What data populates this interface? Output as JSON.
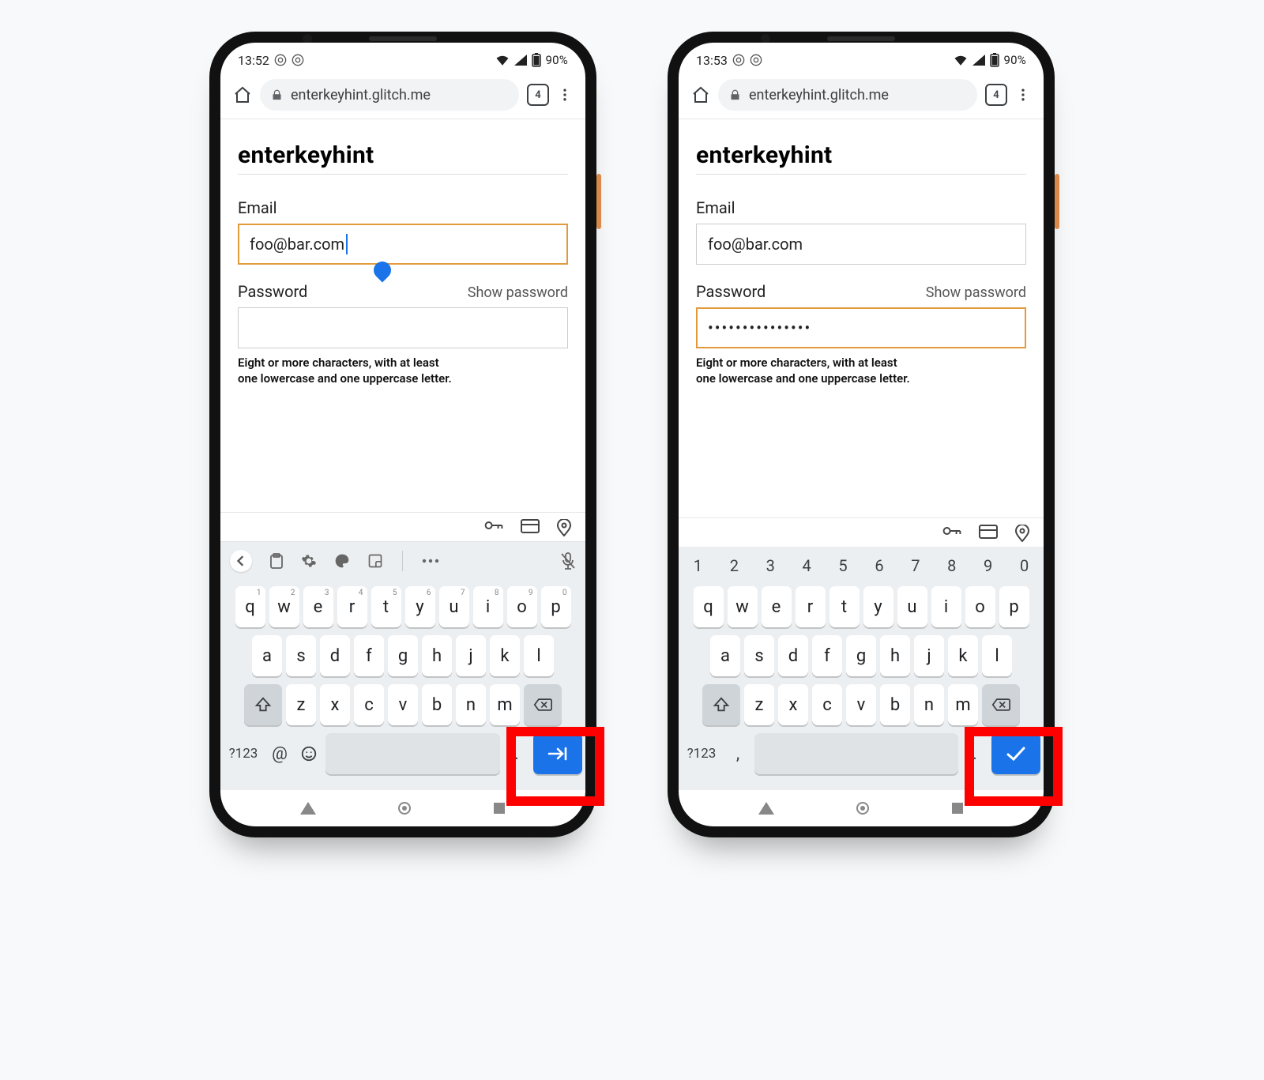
{
  "phones": [
    {
      "status": {
        "time": "13:52",
        "battery_text": "90%"
      },
      "browser": {
        "url": "enterkeyhint.glitch.me",
        "tab_count": "4"
      },
      "page": {
        "title": "enterkeyhint",
        "email_label": "Email",
        "email_value": "foo@bar.com",
        "email_focused": true,
        "password_label": "Password",
        "show_password": "Show password",
        "password_value": "",
        "password_focused": false,
        "helper": "Eight or more characters, with at least\none lowercase and one uppercase letter."
      },
      "keyboard": {
        "show_number_row": false,
        "show_suggestion_strip": true,
        "row1": [
          "q",
          "w",
          "e",
          "r",
          "t",
          "y",
          "u",
          "i",
          "o",
          "p"
        ],
        "row1_sup": [
          "1",
          "2",
          "3",
          "4",
          "5",
          "6",
          "7",
          "8",
          "9",
          "0"
        ],
        "row2": [
          "a",
          "s",
          "d",
          "f",
          "g",
          "h",
          "j",
          "k",
          "l"
        ],
        "row3": [
          "z",
          "x",
          "c",
          "v",
          "b",
          "n",
          "m"
        ],
        "bottom_left_label": "?123",
        "bottom_extra1": "@",
        "bottom_extra2_is_emoji": true,
        "bottom_period": ".",
        "enter_kind": "next"
      }
    },
    {
      "status": {
        "time": "13:53",
        "battery_text": "90%"
      },
      "browser": {
        "url": "enterkeyhint.glitch.me",
        "tab_count": "4"
      },
      "page": {
        "title": "enterkeyhint",
        "email_label": "Email",
        "email_value": "foo@bar.com",
        "email_focused": false,
        "password_label": "Password",
        "show_password": "Show password",
        "password_value": "•••••••••••••••",
        "password_focused": true,
        "helper": "Eight or more characters, with at least\none lowercase and one uppercase letter."
      },
      "keyboard": {
        "show_number_row": true,
        "show_suggestion_strip": false,
        "number_row": [
          "1",
          "2",
          "3",
          "4",
          "5",
          "6",
          "7",
          "8",
          "9",
          "0"
        ],
        "row1": [
          "q",
          "w",
          "e",
          "r",
          "t",
          "y",
          "u",
          "i",
          "o",
          "p"
        ],
        "row1_sup": [],
        "row2": [
          "a",
          "s",
          "d",
          "f",
          "g",
          "h",
          "j",
          "k",
          "l"
        ],
        "row3": [
          "z",
          "x",
          "c",
          "v",
          "b",
          "n",
          "m"
        ],
        "bottom_left_label": "?123",
        "bottom_extra1": ",",
        "bottom_extra2_is_emoji": false,
        "bottom_period": ".",
        "enter_kind": "done"
      }
    }
  ]
}
